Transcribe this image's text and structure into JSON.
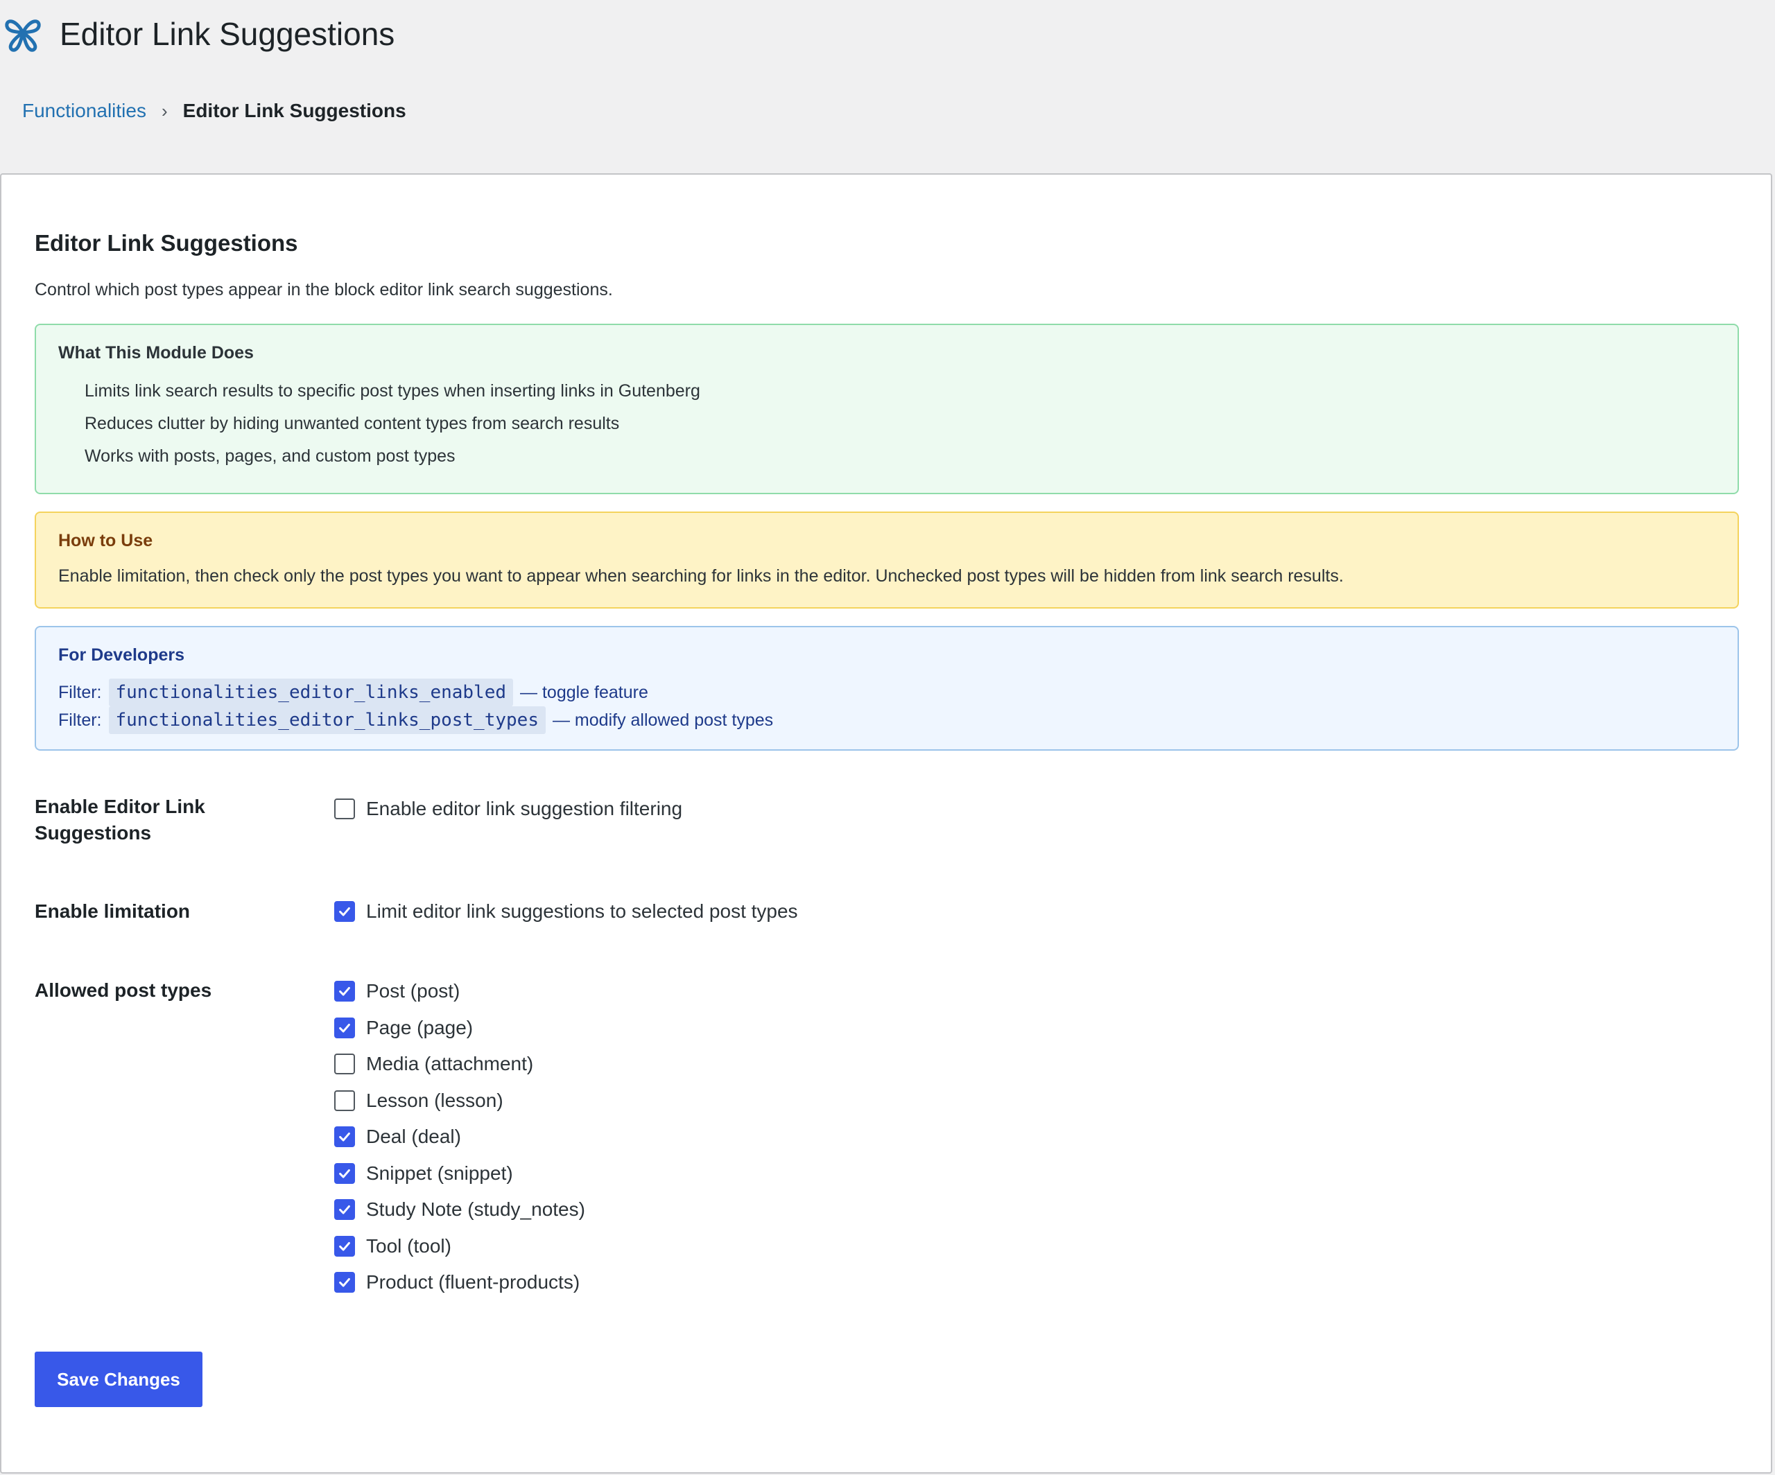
{
  "header": {
    "title": "Editor Link Suggestions",
    "logo_icon": "butterfly-logo-icon",
    "accent_color": "#2271b1"
  },
  "breadcrumb": {
    "parent": "Functionalities",
    "separator": "›",
    "current": "Editor Link Suggestions"
  },
  "card": {
    "title": "Editor Link Suggestions",
    "description": "Control which post types appear in the block editor link search suggestions."
  },
  "module_box": {
    "title": "What This Module Does",
    "items": [
      "Limits link search results to specific post types when inserting links in Gutenberg",
      "Reduces clutter by hiding unwanted content types from search results",
      "Works with posts, pages, and custom post types"
    ]
  },
  "usage_box": {
    "title": "How to Use",
    "text": "Enable limitation, then check only the post types you want to appear when searching for links in the editor. Unchecked post types will be hidden from link search results."
  },
  "dev_box": {
    "title": "For Developers",
    "filters": [
      {
        "prefix": "Filter:",
        "code": "functionalities_editor_links_enabled",
        "note": "— toggle feature"
      },
      {
        "prefix": "Filter:",
        "code": "functionalities_editor_links_post_types",
        "note": "— modify allowed post types"
      }
    ]
  },
  "settings": {
    "enable": {
      "label": "Enable Editor Link Suggestions",
      "option_label": "Enable editor link suggestion filtering",
      "checked": false
    },
    "limitation": {
      "label": "Enable limitation",
      "option_label": "Limit editor link suggestions to selected post types",
      "checked": true
    },
    "post_types": {
      "label": "Allowed post types",
      "options": [
        {
          "label": "Post (post)",
          "checked": true
        },
        {
          "label": "Page (page)",
          "checked": true
        },
        {
          "label": "Media (attachment)",
          "checked": false
        },
        {
          "label": "Lesson (lesson)",
          "checked": false
        },
        {
          "label": "Deal (deal)",
          "checked": true
        },
        {
          "label": "Snippet (snippet)",
          "checked": true
        },
        {
          "label": "Study Note (study_notes)",
          "checked": true
        },
        {
          "label": "Tool (tool)",
          "checked": true
        },
        {
          "label": "Product (fluent-products)",
          "checked": true
        }
      ]
    }
  },
  "actions": {
    "save_label": "Save Changes",
    "button_color": "#3858e9"
  }
}
